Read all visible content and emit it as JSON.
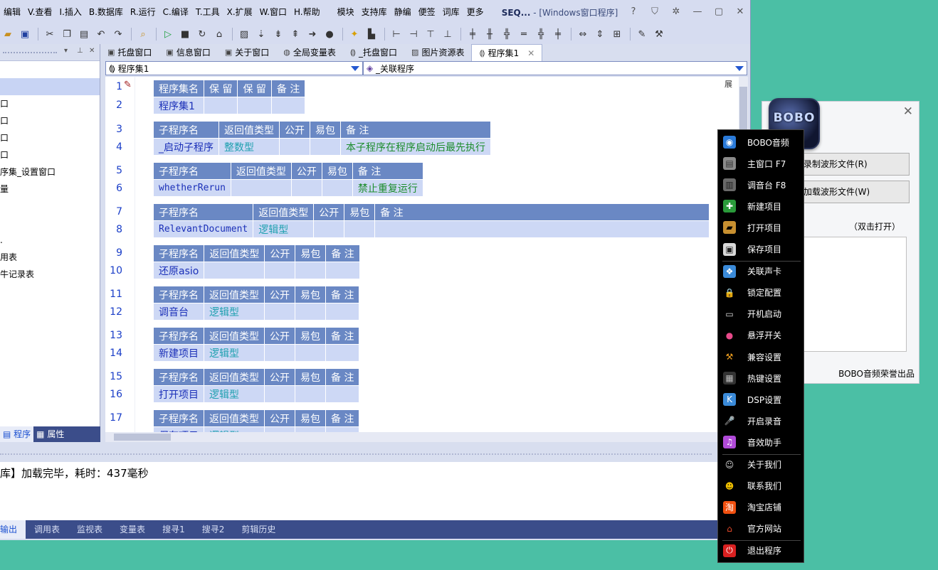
{
  "menu": {
    "items": [
      "编辑",
      "V.查看",
      "I.插入",
      "B.数据库",
      "R.运行",
      "C.编译",
      "T.工具",
      "X.扩展",
      "W.窗口",
      "H.帮助"
    ],
    "extra": [
      "模块",
      "支持库",
      "静编",
      "便签",
      "词库",
      "更多"
    ],
    "title_bold": "SEQ...",
    "title_rest": " - [Windows窗口程序]"
  },
  "left_panel": {
    "rows": [
      "",
      "",
      "口",
      "口",
      "口",
      "口",
      "序集_设置窗口",
      "量",
      "",
      "",
      ".",
      "用表",
      "牛记录表"
    ],
    "tabs": [
      "程序",
      "属性"
    ]
  },
  "doc_tabs": [
    "托盘窗口",
    "信息窗口",
    "关于窗口",
    "全局变量表",
    "_托盘窗口",
    "图片资源表",
    "程序集1"
  ],
  "selectors": {
    "left": "程序集1",
    "right": "_关联程序"
  },
  "code": {
    "expand_label": "展",
    "assembly": {
      "header": [
        "程序集名",
        "保 留",
        "保 留",
        "备 注"
      ],
      "name": "程序集1"
    },
    "sub_header": [
      "子程序名",
      "返回值类型",
      "公开",
      "易包",
      "备 注"
    ],
    "subs": [
      {
        "name": "_启动子程序",
        "type": "整数型",
        "note": "本子程序在程序启动后最先执行"
      },
      {
        "name": "whetherRerun",
        "type": "",
        "note": "禁止重复运行"
      },
      {
        "name": "RelevantDocument",
        "type": "逻辑型",
        "note": ""
      },
      {
        "name": "还原asio",
        "type": "",
        "note": ""
      },
      {
        "name": "调音台",
        "type": "逻辑型",
        "note": ""
      },
      {
        "name": "新建项目",
        "type": "逻辑型",
        "note": ""
      },
      {
        "name": "打开项目",
        "type": "逻辑型",
        "note": ""
      },
      {
        "name": "保存项目",
        "type": "逻辑型",
        "note": ""
      }
    ],
    "line_numbers": [
      "1",
      "2",
      "3",
      "4",
      "5",
      "6",
      "7",
      "8",
      "9",
      "10",
      "11",
      "12",
      "13",
      "14",
      "15",
      "16",
      "17"
    ]
  },
  "output": {
    "text": "库】加载完毕，耗时：437毫秒"
  },
  "bottom_tabs": [
    "输出",
    "调用表",
    "监视表",
    "变量表",
    "搜寻1",
    "搜寻2",
    "剪辑历史"
  ],
  "bobo_dialog": {
    "logo_text": "BOBO",
    "btn_record": "录制波形文件(R)",
    "btn_load": "加载波形文件(W)",
    "hint": "（双击打开）",
    "footer": "BOBO音频荣誉出品"
  },
  "popup_menu": {
    "groups": [
      [
        {
          "label": "BOBO音频",
          "icon": "globe-icon"
        },
        {
          "label": "主窗口 F7",
          "icon": "window-icon"
        },
        {
          "label": "调音台 F8",
          "icon": "mixer-icon"
        },
        {
          "label": "新建项目",
          "icon": "new-file-icon"
        },
        {
          "label": "打开项目",
          "icon": "open-folder-icon"
        },
        {
          "label": "保存项目",
          "icon": "save-disk-icon"
        }
      ],
      [
        {
          "label": "关联声卡",
          "icon": "soundcard-icon"
        },
        {
          "label": "锁定配置",
          "icon": "lock-icon"
        },
        {
          "label": "开机启动",
          "icon": "monitor-icon"
        },
        {
          "label": "悬浮开关",
          "icon": "color-wheel-icon"
        },
        {
          "label": "兼容设置",
          "icon": "tools-icon"
        },
        {
          "label": "热键设置",
          "icon": "keyboard-icon"
        },
        {
          "label": "DSP设置",
          "icon": "dsp-icon"
        },
        {
          "label": "开启录音",
          "icon": "microphone-icon"
        },
        {
          "label": "音效助手",
          "icon": "music-note-icon"
        }
      ],
      [
        {
          "label": "关于我们",
          "icon": "person-icon"
        },
        {
          "label": "联系我们",
          "icon": "penguin-icon"
        },
        {
          "label": "淘宝店铺",
          "icon": "taobao-icon"
        },
        {
          "label": "官方网站",
          "icon": "home-icon"
        }
      ],
      [
        {
          "label": "退出程序",
          "icon": "exit-icon"
        }
      ]
    ]
  }
}
